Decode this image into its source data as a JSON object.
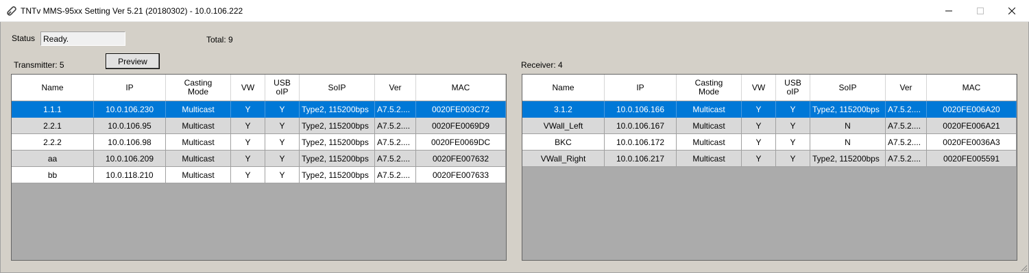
{
  "window": {
    "title": "TNTv MMS-95xx Setting Ver 5.21 (20180302) - 10.0.106.222"
  },
  "status": {
    "label": "Status",
    "value": "Ready.",
    "total": "Total: 9"
  },
  "transmitter": {
    "label": "Transmitter: 5",
    "preview_label": "Preview"
  },
  "receiver": {
    "label": "Receiver: 4"
  },
  "tx_table": {
    "headers": [
      "Name",
      "IP",
      "Casting\nMode",
      "VW",
      "USB\noIP",
      "SoIP",
      "Ver",
      "MAC"
    ],
    "rows": [
      [
        "1.1.1",
        "10.0.106.230",
        "Multicast",
        "Y",
        "Y",
        "Type2, 115200bps",
        "A7.5.2....",
        "0020FE003C72"
      ],
      [
        "2.2.1",
        "10.0.106.95",
        "Multicast",
        "Y",
        "Y",
        "Type2, 115200bps",
        "A7.5.2....",
        "0020FE0069D9"
      ],
      [
        "2.2.2",
        "10.0.106.98",
        "Multicast",
        "Y",
        "Y",
        "Type2, 115200bps",
        "A7.5.2....",
        "0020FE0069DC"
      ],
      [
        "aa",
        "10.0.106.209",
        "Multicast",
        "Y",
        "Y",
        "Type2, 115200bps",
        "A7.5.2....",
        "0020FE007632"
      ],
      [
        "bb",
        "10.0.118.210",
        "Multicast",
        "Y",
        "Y",
        "Type2, 115200bps",
        "A7.5.2....",
        "0020FE007633"
      ]
    ]
  },
  "rx_table": {
    "headers": [
      "Name",
      "IP",
      "Casting\nMode",
      "VW",
      "USB\noIP",
      "SoIP",
      "Ver",
      "MAC"
    ],
    "rows": [
      [
        "3.1.2",
        "10.0.106.166",
        "Multicast",
        "Y",
        "Y",
        "Type2, 115200bps",
        "A7.5.2....",
        "0020FE006A20"
      ],
      [
        "VWall_Left",
        "10.0.106.167",
        "Multicast",
        "Y",
        "Y",
        "N",
        "A7.5.2....",
        "0020FE006A21"
      ],
      [
        "BKC",
        "10.0.106.172",
        "Multicast",
        "Y",
        "Y",
        "N",
        "A7.5.2....",
        "0020FE0036A3"
      ],
      [
        "VWall_Right",
        "10.0.106.217",
        "Multicast",
        "Y",
        "Y",
        "Type2, 115200bps",
        "A7.5.2....",
        "0020FE005591"
      ]
    ]
  },
  "colors": {
    "selection": "#0078d7",
    "grid_bg": "#ababab",
    "window_bg": "#d4d0c8"
  },
  "icons": {
    "app": "link-icon",
    "minimize": "minimize-icon",
    "maximize": "maximize-icon",
    "close": "close-icon"
  }
}
